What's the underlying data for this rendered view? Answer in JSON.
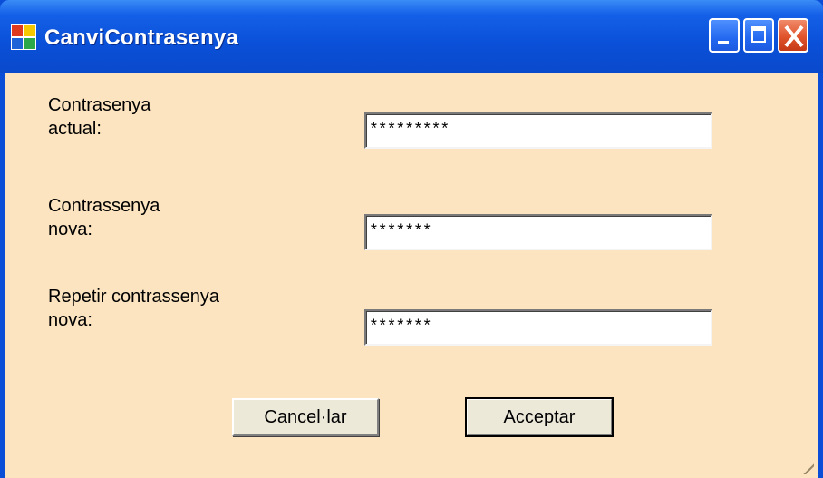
{
  "window": {
    "title": "CanviContrasenya",
    "icon": "windows-forms-app-icon",
    "controls": {
      "minimize": "minimize-icon",
      "maximize": "maximize-icon",
      "close": "close-icon"
    },
    "colors": {
      "titlebar": "#0a50d8",
      "client_background": "#fce4c0",
      "close_button": "#e0542c"
    }
  },
  "form": {
    "current_password": {
      "label": "Contrasenya\nactual:",
      "value": "*********"
    },
    "new_password": {
      "label": "Contrassenya\nnova:",
      "value": "*******"
    },
    "repeat_new_password": {
      "label": "Repetir contrassenya\nnova:",
      "value": "*******"
    }
  },
  "buttons": {
    "cancel": "Cancel·lar",
    "accept": "Acceptar"
  }
}
